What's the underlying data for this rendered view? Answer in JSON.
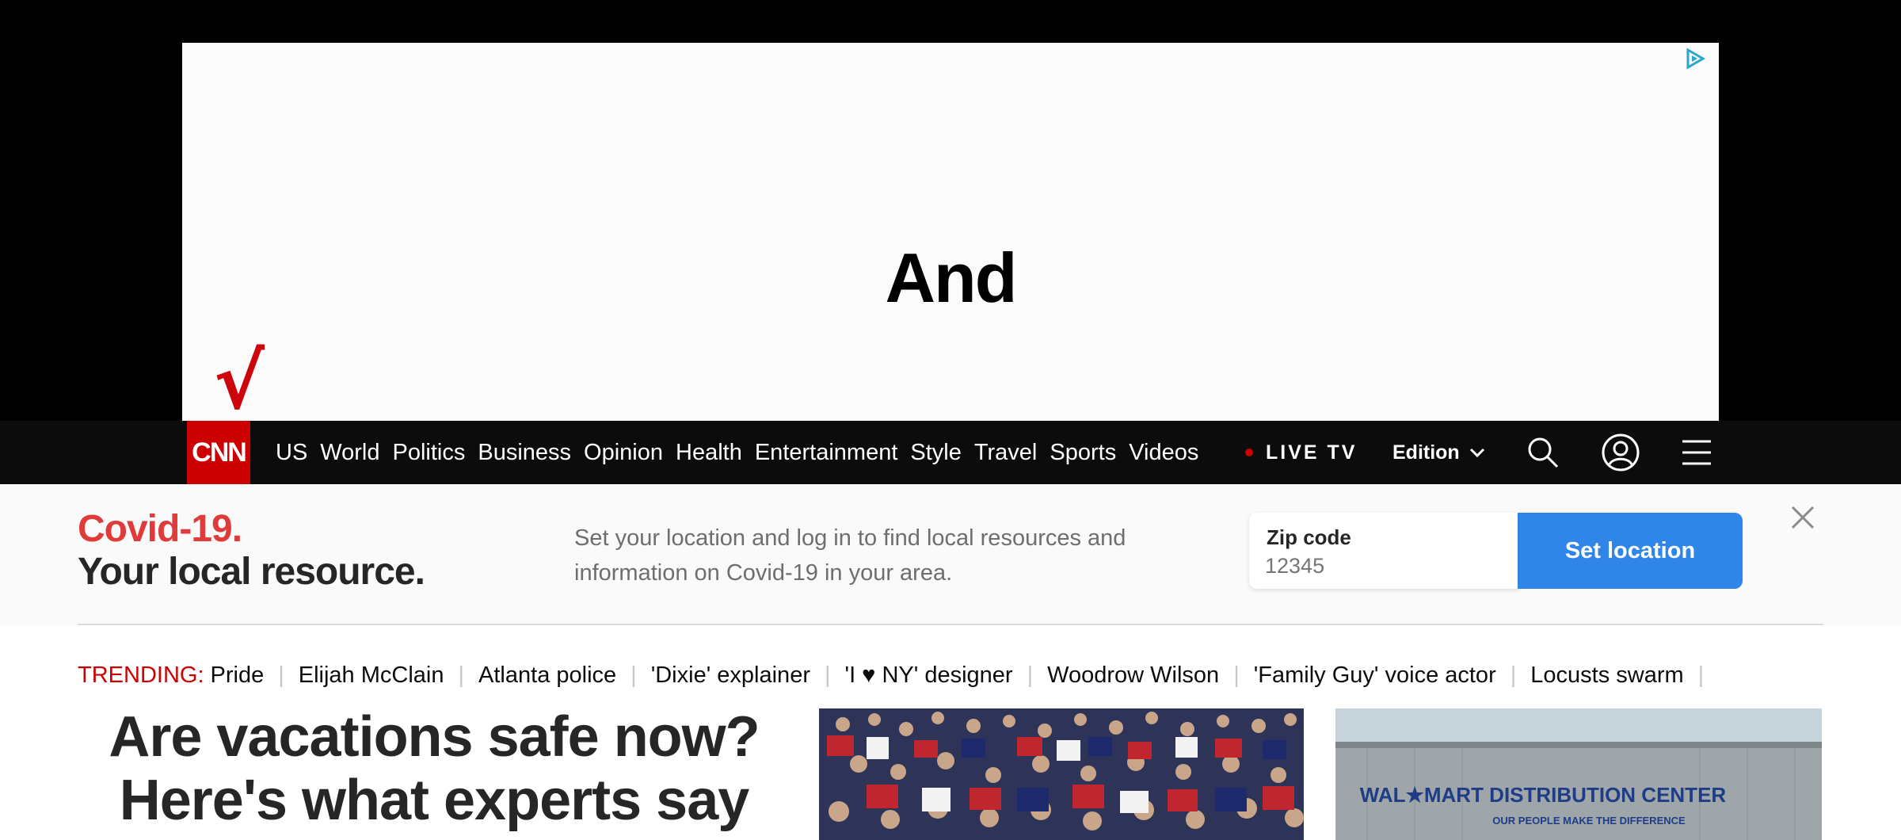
{
  "ad": {
    "text": "And",
    "brand_color": "#cd040b",
    "check_glyph": "√"
  },
  "nav": {
    "logo_text": "CNN",
    "links": [
      "US",
      "World",
      "Politics",
      "Business",
      "Opinion",
      "Health",
      "Entertainment",
      "Style",
      "Travel",
      "Sports",
      "Videos"
    ],
    "live_tv": "LIVE TV",
    "edition": "Edition",
    "icons": [
      "search-icon",
      "account-icon",
      "menu-icon"
    ]
  },
  "covid": {
    "title_line1": "Covid-19.",
    "title_line2": "Your local resource.",
    "description": "Set your location and log in to find local resources and information on Covid-19 in your area.",
    "zip_label": "Zip code",
    "zip_placeholder": "12345",
    "button": "Set location"
  },
  "trending": {
    "label": "TRENDING:",
    "items": [
      "Pride",
      "Elijah McClain",
      "Atlanta police",
      "'Dixie' explainer",
      "'I ♥ NY' designer",
      "Woodrow Wilson",
      "'Family Guy' voice actor",
      "Locusts swarm"
    ]
  },
  "main": {
    "headline": "Are vacations safe now? Here's what experts say",
    "image2_sign_line1": "WAL★MART  DISTRIBUTION CENTER",
    "image2_sign_line2": "OUR PEOPLE MAKE THE DIFFERENCE"
  },
  "colors": {
    "accent_red": "#cc0000",
    "covid_red": "#e03b3b",
    "button_blue": "#2f86e8",
    "nav_bg": "#0c0c0c"
  }
}
